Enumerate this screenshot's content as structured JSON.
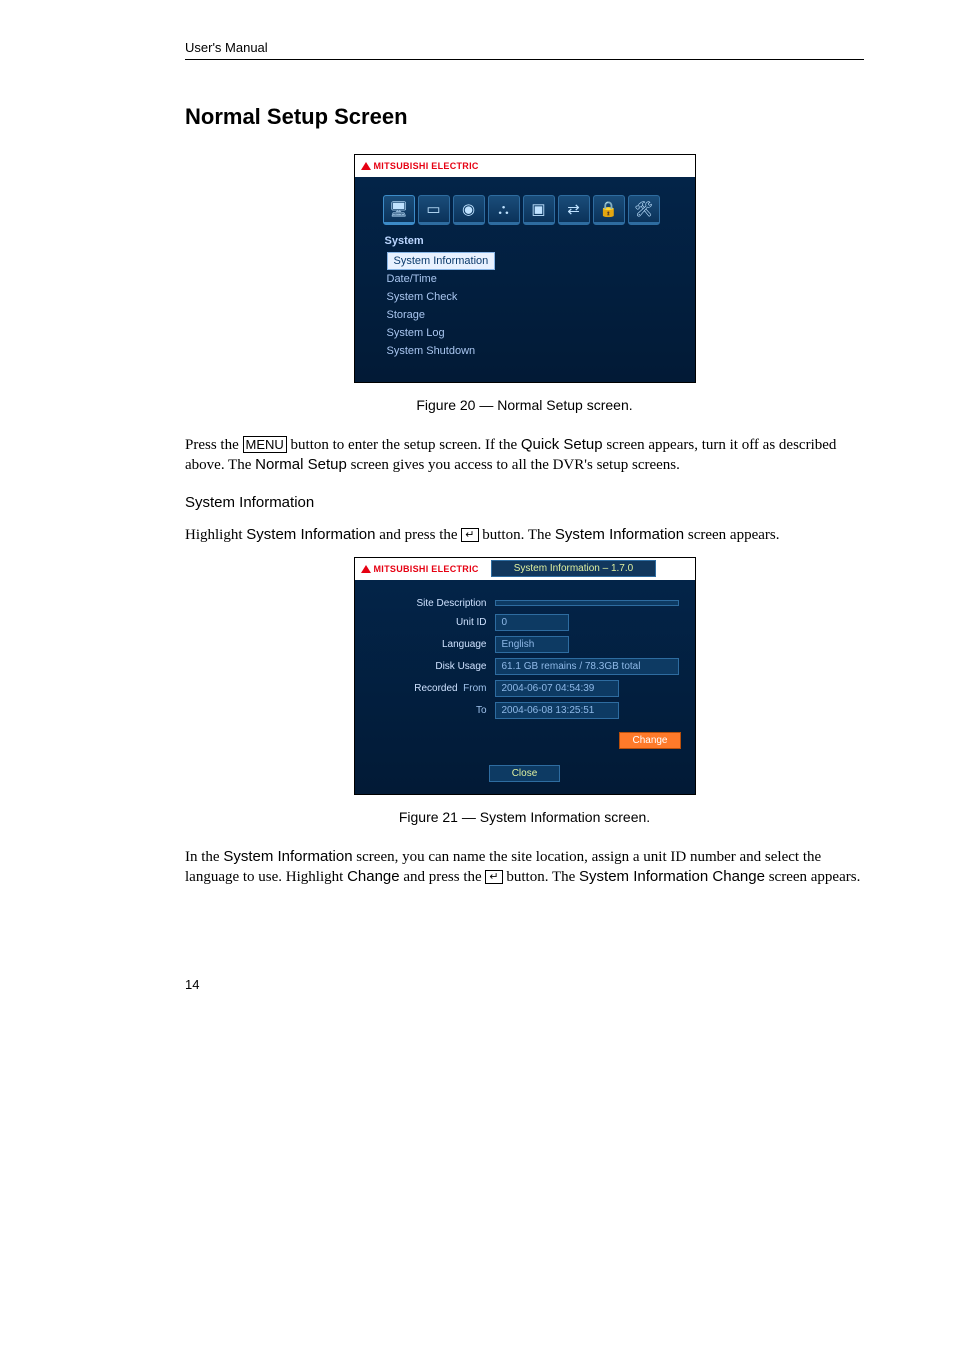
{
  "header": {
    "running": "User's Manual"
  },
  "title": "Normal Setup Screen",
  "figure1": {
    "brand": "MITSUBISHI ELECTRIC",
    "panel_label": "System",
    "toolbar_icons": [
      "monitor-icon",
      "camera-icon",
      "record-dot-icon",
      "calendar-icon",
      "display-icon",
      "network-icon",
      "lock-icon",
      "tools-icon"
    ],
    "menu": [
      {
        "label": "System Information",
        "selected": true
      },
      {
        "label": "Date/Time",
        "selected": false
      },
      {
        "label": "System Check",
        "selected": false
      },
      {
        "label": "Storage",
        "selected": false
      },
      {
        "label": "System Log",
        "selected": false
      },
      {
        "label": "System Shutdown",
        "selected": false
      }
    ],
    "caption": "Figure 20 — Normal Setup screen."
  },
  "para1": {
    "t1": "Press the ",
    "menu_btn": "MENU",
    "t2": " button to enter the setup screen.  If the ",
    "quick": "Quick Setup",
    "t3": " screen appears, turn it off as described above.  The ",
    "normal": "Normal Setup",
    "t4": " screen gives you access to all the DVR's setup screens."
  },
  "subsection": "System Information",
  "para2": {
    "t1": "Highlight ",
    "sysinfo": "System Information",
    "t2": " and press the ",
    "enter": "↵",
    "t3": " button.  The ",
    "sysinfo2": "System Information",
    "t4": " screen appears."
  },
  "figure2": {
    "brand": "MITSUBISHI ELECTRIC",
    "window_title": "System Information –  1.7.0",
    "rows": {
      "site_description": {
        "label": "Site Description",
        "value": ""
      },
      "unit_id": {
        "label": "Unit ID",
        "value": "0"
      },
      "language": {
        "label": "Language",
        "value": "English"
      },
      "disk_usage": {
        "label": "Disk Usage",
        "value": "61.1 GB remains / 78.3GB total"
      },
      "recorded": {
        "label": "Recorded",
        "from_label": "From",
        "from_value": "2004-06-07 04:54:39",
        "to_label": "To",
        "to_value": "2004-06-08 13:25:51"
      }
    },
    "change_btn": "Change",
    "close_btn": "Close",
    "caption": "Figure 21 — System Information screen."
  },
  "para3": {
    "t1": "In the ",
    "sysinfo": "System Information",
    "t2": " screen, you can name the site location, assign a unit ID number and select the language to use.  Highlight ",
    "change": "Change",
    "t3": " and press the ",
    "enter": "↵",
    "t4": " button.  The ",
    "sic": "System Information Change",
    "t5": " screen appears."
  },
  "page_number": "14"
}
